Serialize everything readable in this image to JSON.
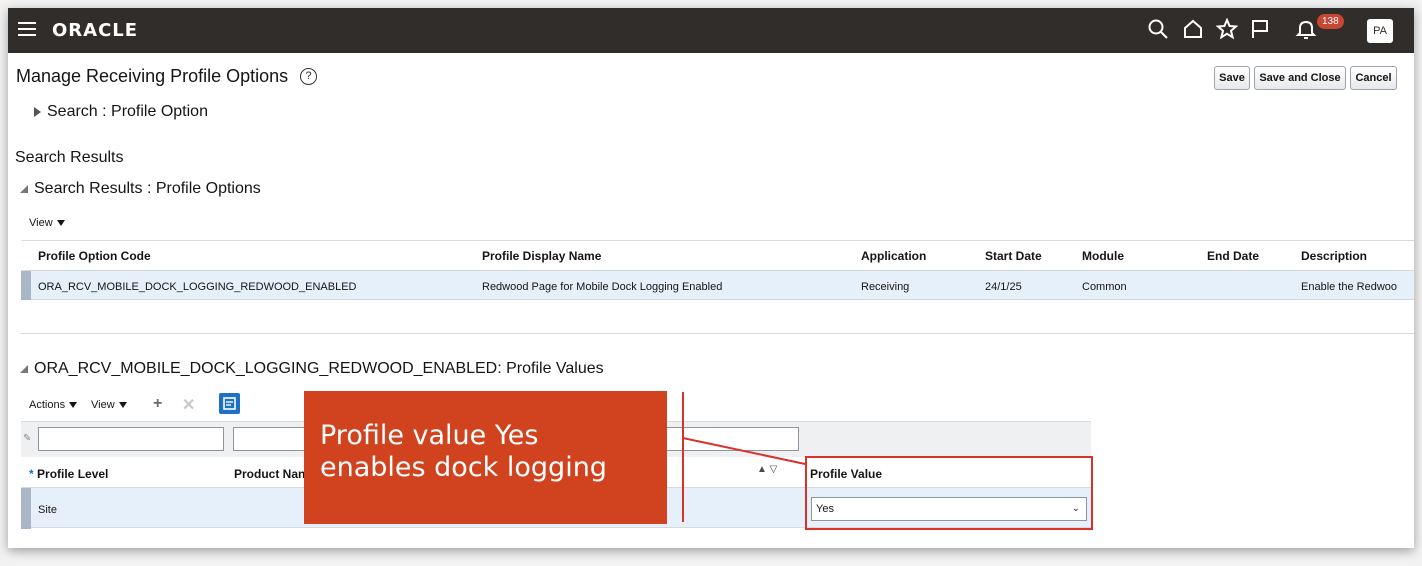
{
  "header": {
    "logo": "ORACLE",
    "notification_count": "138",
    "avatar": "PA",
    "icons": [
      "menu-icon",
      "search-icon",
      "home-icon",
      "favorites-icon",
      "flag-icon",
      "bell-icon"
    ]
  },
  "page": {
    "title": "Manage Receiving Profile Options",
    "help_icon": "?",
    "buttons": {
      "save": "Save",
      "save_close": "Save and Close",
      "cancel": "Cancel"
    }
  },
  "search": {
    "label": "Search : Profile Option"
  },
  "results": {
    "heading": "Search Results",
    "subheading": "Search Results : Profile Options",
    "view_menu": "View",
    "columns": [
      "Profile Option Code",
      "Profile Display Name",
      "Application",
      "Start Date",
      "Module",
      "End Date",
      "Description"
    ],
    "rows": [
      {
        "code": "ORA_RCV_MOBILE_DOCK_LOGGING_REDWOOD_ENABLED",
        "display_name": "Redwood Page for Mobile Dock Logging Enabled",
        "application": "Receiving",
        "start_date": "24/1/25",
        "module": "Common",
        "end_date": "",
        "description": "Enable the Redwoo"
      }
    ]
  },
  "values": {
    "heading": "ORA_RCV_MOBILE_DOCK_LOGGING_REDWOOD_ENABLED: Profile Values",
    "actions_menu": "Actions",
    "view_menu": "View",
    "columns": {
      "level": "Profile Level",
      "product": "Product Nan",
      "value": "Profile Value"
    },
    "required_mark": "*",
    "rows": [
      {
        "level": "Site",
        "value": "Yes"
      }
    ]
  },
  "callout": {
    "line1": "Profile value Yes",
    "line2": "enables dock logging"
  },
  "colors": {
    "topbar": "#312d2a",
    "callout": "#d1431e",
    "highlight": "#d9322b",
    "selected_row": "#e6f0fa"
  }
}
